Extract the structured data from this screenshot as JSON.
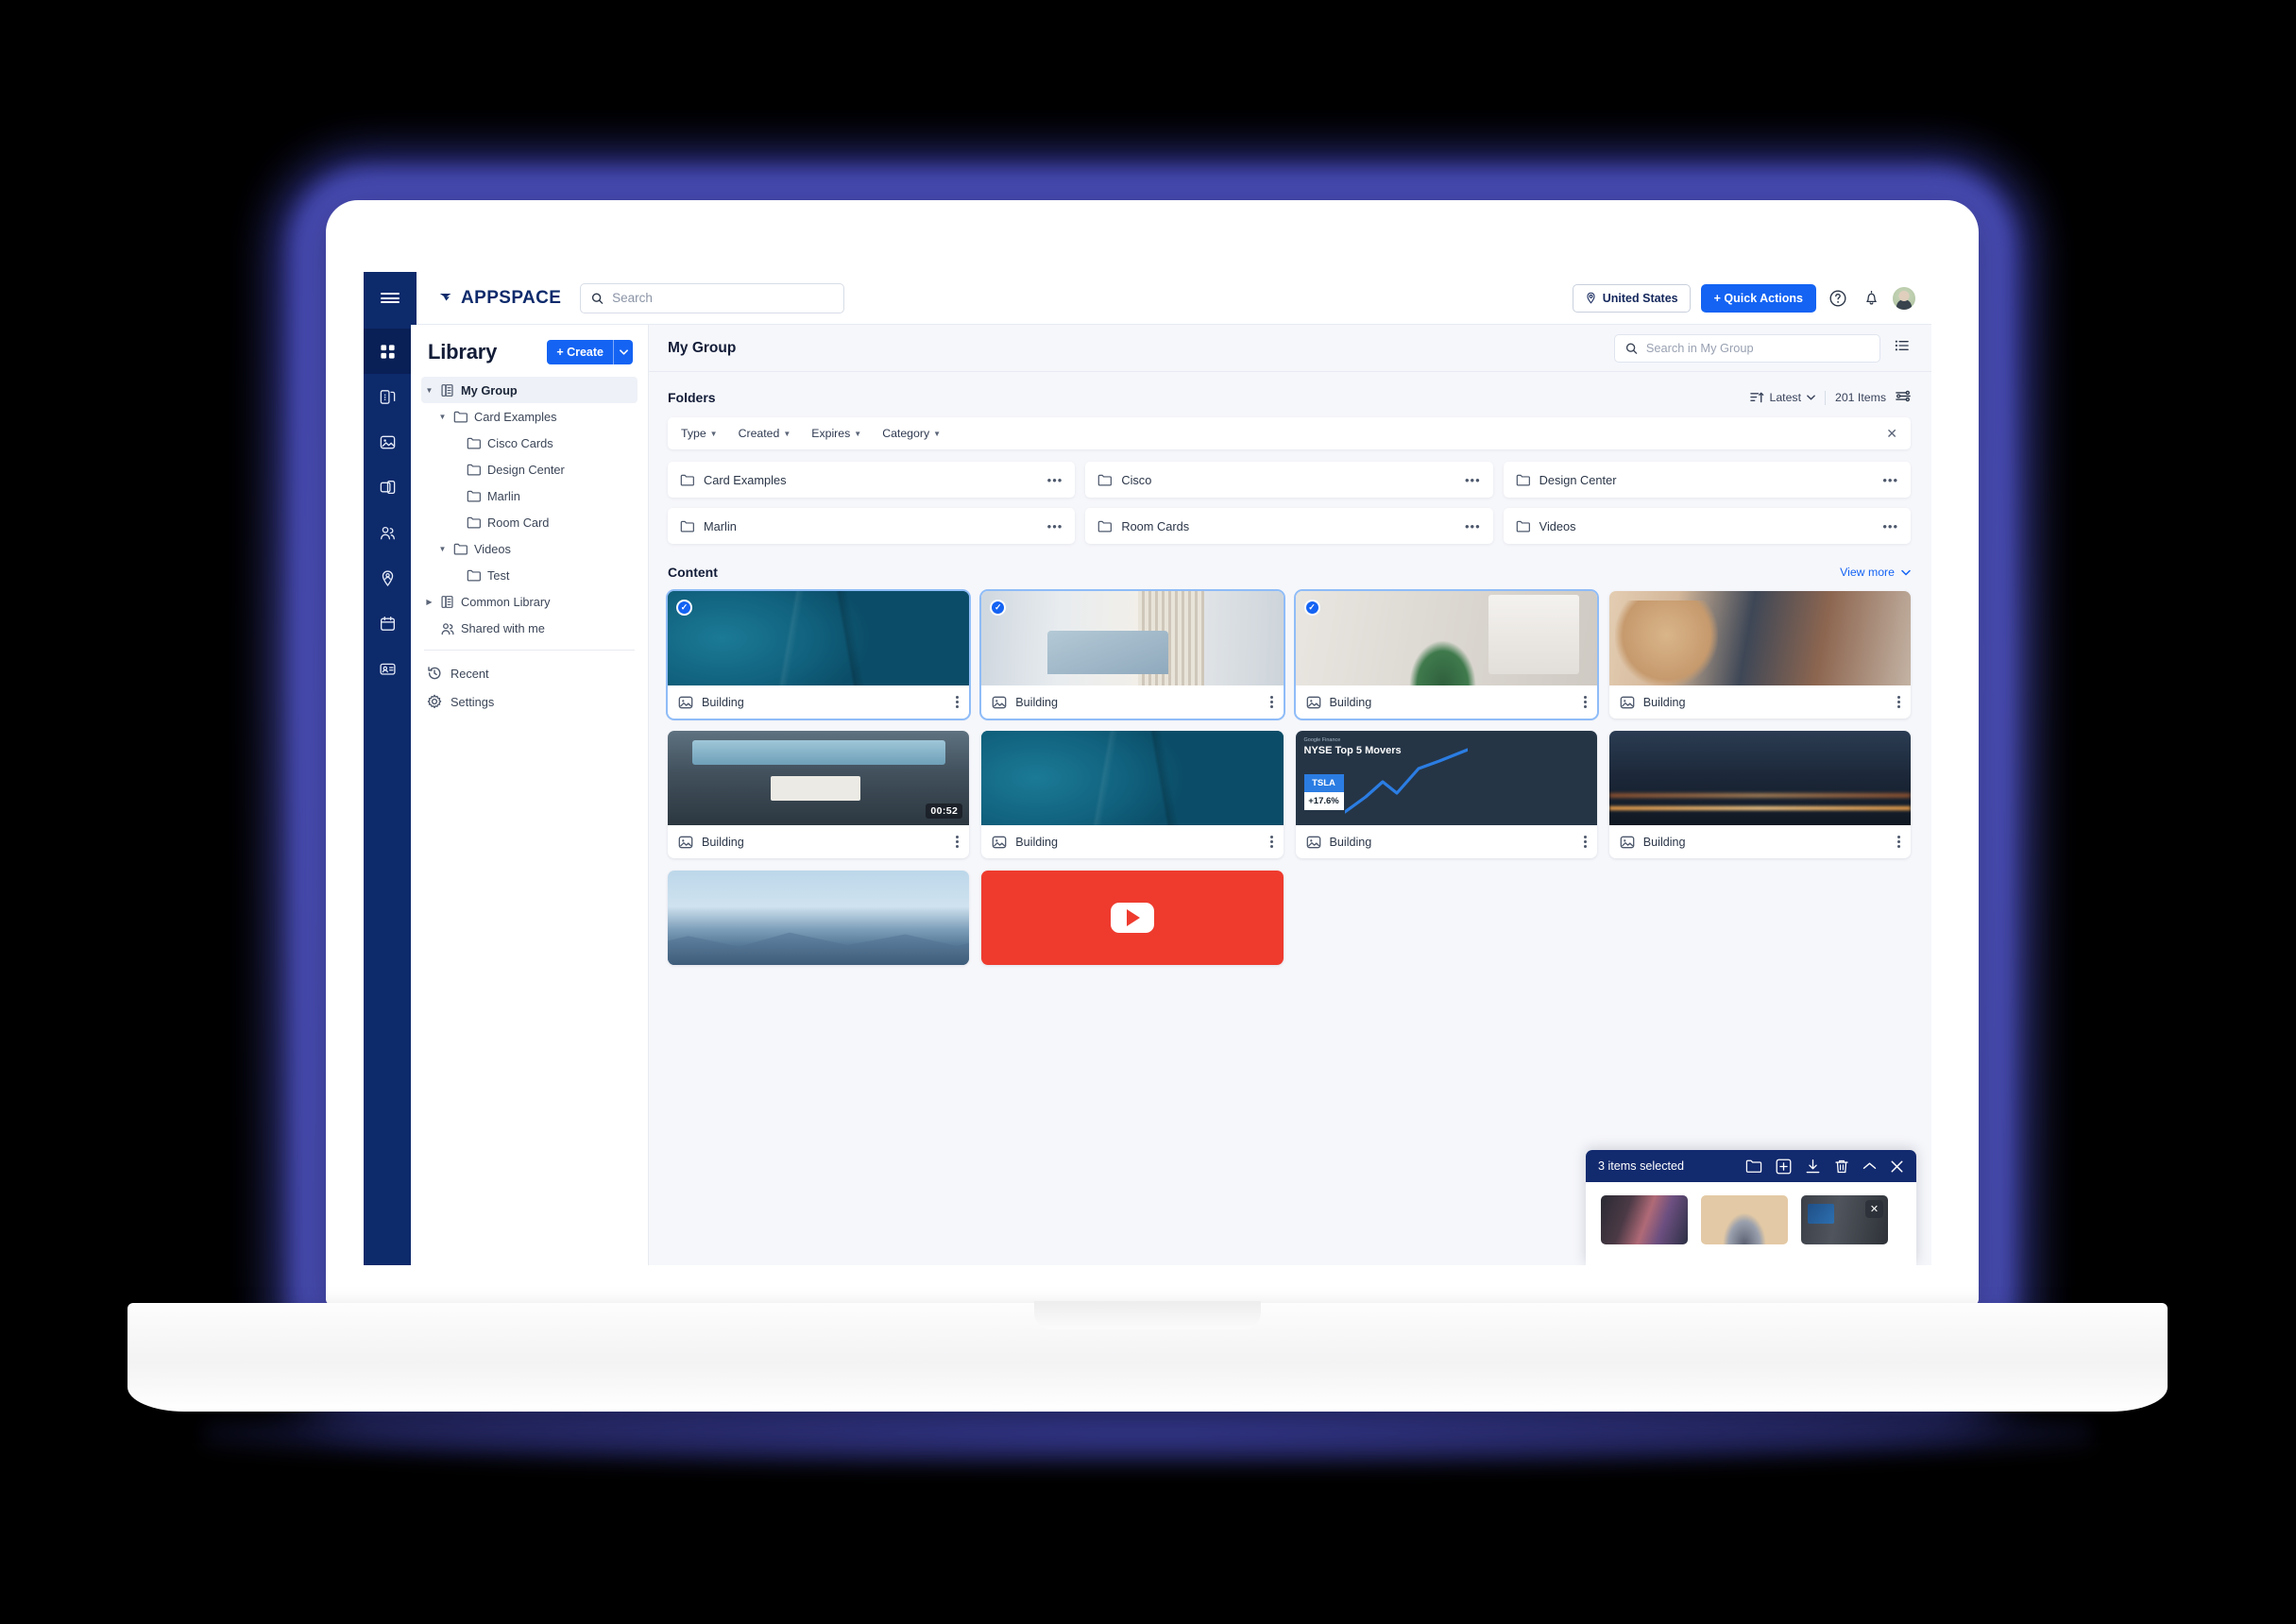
{
  "topbar": {
    "brand": "APPSPACE",
    "search_placeholder": "Search",
    "search_value": "",
    "region_label": "United States",
    "quick_actions_label": "+ Quick Actions"
  },
  "sidebar": {
    "title": "Library",
    "create_label": "+ Create",
    "tree": [
      {
        "label": "My Group",
        "indent": 0,
        "icon": "library-icon",
        "caret": "down",
        "selected": true
      },
      {
        "label": "Card Examples",
        "indent": 1,
        "icon": "folder-icon",
        "caret": "down",
        "selected": false
      },
      {
        "label": "Cisco Cards",
        "indent": 2,
        "icon": "folder-icon",
        "caret": "none",
        "selected": false
      },
      {
        "label": "Design Center",
        "indent": 2,
        "icon": "folder-icon",
        "caret": "none",
        "selected": false
      },
      {
        "label": "Marlin",
        "indent": 2,
        "icon": "folder-icon",
        "caret": "none",
        "selected": false
      },
      {
        "label": "Room Card",
        "indent": 2,
        "icon": "folder-icon",
        "caret": "none",
        "selected": false
      },
      {
        "label": "Videos",
        "indent": 1,
        "icon": "folder-icon",
        "caret": "down",
        "selected": false
      },
      {
        "label": "Test",
        "indent": 2,
        "icon": "folder-icon",
        "caret": "none",
        "selected": false
      },
      {
        "label": "Common Library",
        "indent": 0,
        "icon": "library-icon",
        "caret": "right",
        "selected": false
      },
      {
        "label": "Shared with me",
        "indent": 0,
        "icon": "people-icon",
        "caret": "none",
        "selected": false
      }
    ],
    "links": [
      {
        "label": "Recent",
        "icon": "history-icon"
      },
      {
        "label": "Settings",
        "icon": "gear-icon"
      }
    ]
  },
  "rail": [
    {
      "name": "dashboard-icon",
      "active": true
    },
    {
      "name": "devices-icon",
      "active": false
    },
    {
      "name": "media-icon",
      "active": false
    },
    {
      "name": "channels-icon",
      "active": false
    },
    {
      "name": "users-icon",
      "active": false
    },
    {
      "name": "visitor-icon",
      "active": false
    },
    {
      "name": "calendar-icon",
      "active": false
    },
    {
      "name": "badge-icon",
      "active": false
    }
  ],
  "main": {
    "title": "My Group",
    "search_placeholder": "Search in My Group",
    "search_value": "",
    "folders_label": "Folders",
    "sort_label": "Latest",
    "items_count": "201 Items",
    "filters": [
      {
        "label": "Type"
      },
      {
        "label": "Created"
      },
      {
        "label": "Expires"
      },
      {
        "label": "Category"
      }
    ],
    "folders": [
      {
        "label": "Card Examples"
      },
      {
        "label": "Cisco"
      },
      {
        "label": "Design Center"
      },
      {
        "label": "Marlin"
      },
      {
        "label": "Room Cards"
      },
      {
        "label": "Videos"
      }
    ],
    "content_label": "Content",
    "view_more_label": "View more",
    "cards": [
      {
        "label": "Building",
        "art": "art-leaf",
        "selected": true,
        "duration": ""
      },
      {
        "label": "Building",
        "art": "art-desk",
        "selected": true,
        "duration": ""
      },
      {
        "label": "Building",
        "art": "art-plant",
        "selected": true,
        "duration": ""
      },
      {
        "label": "Building",
        "art": "art-people",
        "selected": false,
        "duration": ""
      },
      {
        "label": "Building",
        "art": "art-car",
        "selected": false,
        "duration": "00:52"
      },
      {
        "label": "Building",
        "art": "art-leaf",
        "selected": false,
        "duration": ""
      },
      {
        "label": "Building",
        "art": "art-stock",
        "selected": false,
        "duration": ""
      },
      {
        "label": "Building",
        "art": "art-city",
        "selected": false,
        "duration": ""
      },
      {
        "label": "",
        "art": "art-mtn",
        "selected": false,
        "duration": ""
      },
      {
        "label": "",
        "art": "art-yt",
        "selected": false,
        "duration": ""
      }
    ],
    "stock_card": {
      "source": "Google Finance",
      "title": "NYSE Top 5 Movers",
      "ticker": "TSLA",
      "change": "+17.6%"
    }
  },
  "selection": {
    "label": "3 items selected",
    "actions": [
      {
        "name": "move-to-folder-icon"
      },
      {
        "name": "add-to-icon"
      },
      {
        "name": "download-icon"
      },
      {
        "name": "delete-icon"
      },
      {
        "name": "collapse-icon"
      },
      {
        "name": "close-icon"
      }
    ],
    "thumbs": [
      {
        "art": "st-car",
        "removable": false
      },
      {
        "art": "st-team",
        "removable": false
      },
      {
        "art": "st-room",
        "removable": true
      }
    ]
  },
  "colors": {
    "brand_navy": "#0d2a6b",
    "accent_blue": "#1463f3",
    "selection_navy": "#122a6e",
    "page_bg": "#f6f7fb",
    "glow": "#4a4eb5"
  }
}
